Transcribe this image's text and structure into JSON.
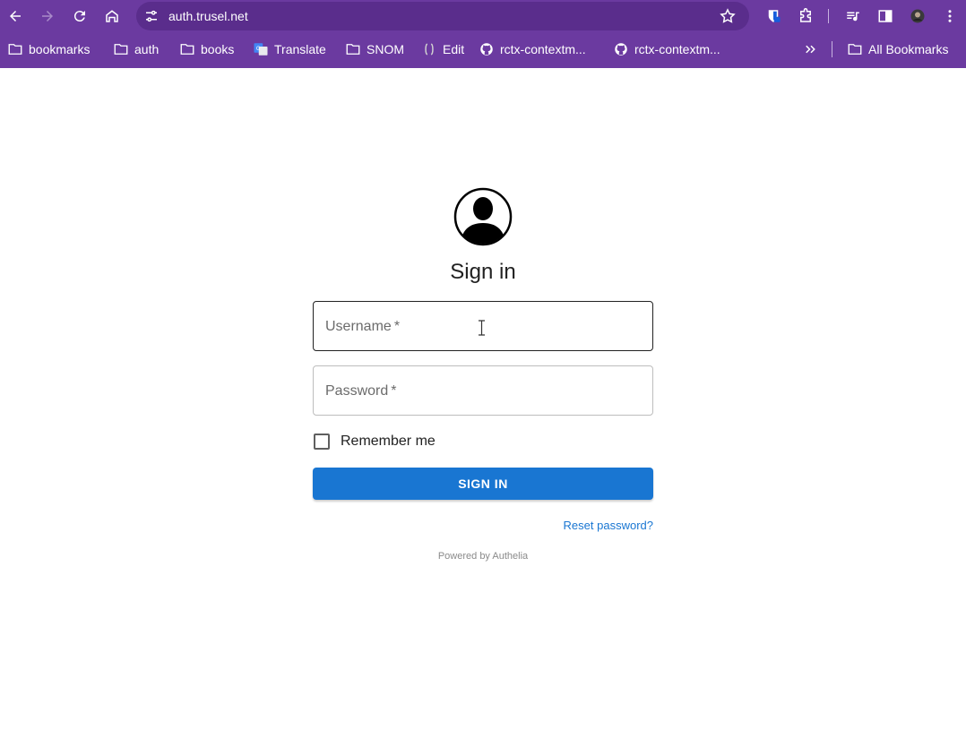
{
  "browser": {
    "url": "auth.trusel.net",
    "chrome_color": "#6b3aa0",
    "bookmarks": [
      {
        "label": "bookmarks",
        "icon": "folder-icon"
      },
      {
        "label": "auth",
        "icon": "folder-icon"
      },
      {
        "label": "books",
        "icon": "folder-icon"
      },
      {
        "label": "Translate",
        "icon": "translate-icon"
      },
      {
        "label": "SNOM",
        "icon": "folder-icon"
      },
      {
        "label": "Edit",
        "icon": "edit-icon"
      },
      {
        "label": "rctx-contextm...",
        "icon": "github-icon"
      },
      {
        "label": "rctx-contextm...",
        "icon": "github-icon"
      }
    ],
    "all_bookmarks": "All Bookmarks"
  },
  "signin": {
    "title": "Sign in",
    "username_placeholder": "Username",
    "password_placeholder": "Password",
    "required_mark": "*",
    "remember_label": "Remember me",
    "remember_checked": false,
    "button_label": "SIGN IN",
    "reset_link": "Reset password?",
    "powered_by": "Powered by Authelia",
    "accent_color": "#1976d2"
  }
}
